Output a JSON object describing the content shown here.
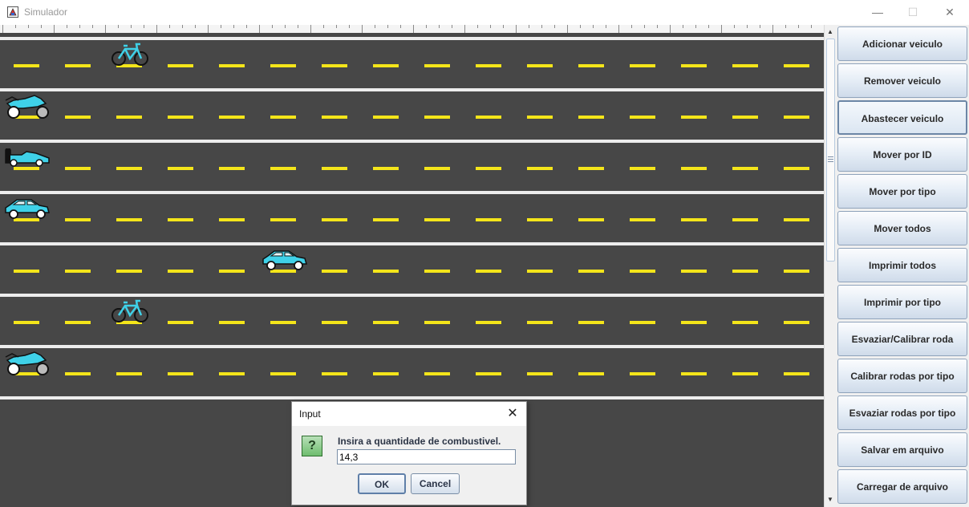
{
  "window": {
    "title": "Simulador",
    "minimize_glyph": "—",
    "maximize_glyph": "☐",
    "close_glyph": "✕"
  },
  "road": {
    "lanes": [
      {
        "vehicle": "bicycle"
      },
      {
        "vehicle": "motorcycle"
      },
      {
        "vehicle": "race-car"
      },
      {
        "vehicle": "car"
      },
      {
        "vehicle": "car"
      },
      {
        "vehicle": "bicycle"
      },
      {
        "vehicle": "motorcycle"
      }
    ],
    "colors": {
      "asphalt": "#474747",
      "lane_marking": "#f4e51a",
      "lane_border": "#ededed",
      "vehicle": "#3fd1e8"
    }
  },
  "sidebar": {
    "buttons": [
      {
        "label": "Adicionar veiculo"
      },
      {
        "label": "Remover veiculo"
      },
      {
        "label": "Abastecer veiculo",
        "selected": true
      },
      {
        "label": "Mover por ID"
      },
      {
        "label": "Mover por tipo"
      },
      {
        "label": "Mover todos"
      },
      {
        "label": "Imprimir todos"
      },
      {
        "label": "Imprimir por tipo"
      },
      {
        "label": "Esvaziar/Calibrar roda"
      },
      {
        "label": "Calibrar rodas por tipo"
      },
      {
        "label": "Esvaziar rodas por tipo"
      },
      {
        "label": "Salvar em arquivo"
      },
      {
        "label": "Carregar de arquivo"
      }
    ]
  },
  "dialog": {
    "title": "Input",
    "icon": "question-icon",
    "icon_glyph": "?",
    "close_glyph": "✕",
    "message": "Insira a quantidade de combustivel.",
    "input_value": "14,3",
    "ok_label": "OK",
    "cancel_label": "Cancel"
  }
}
